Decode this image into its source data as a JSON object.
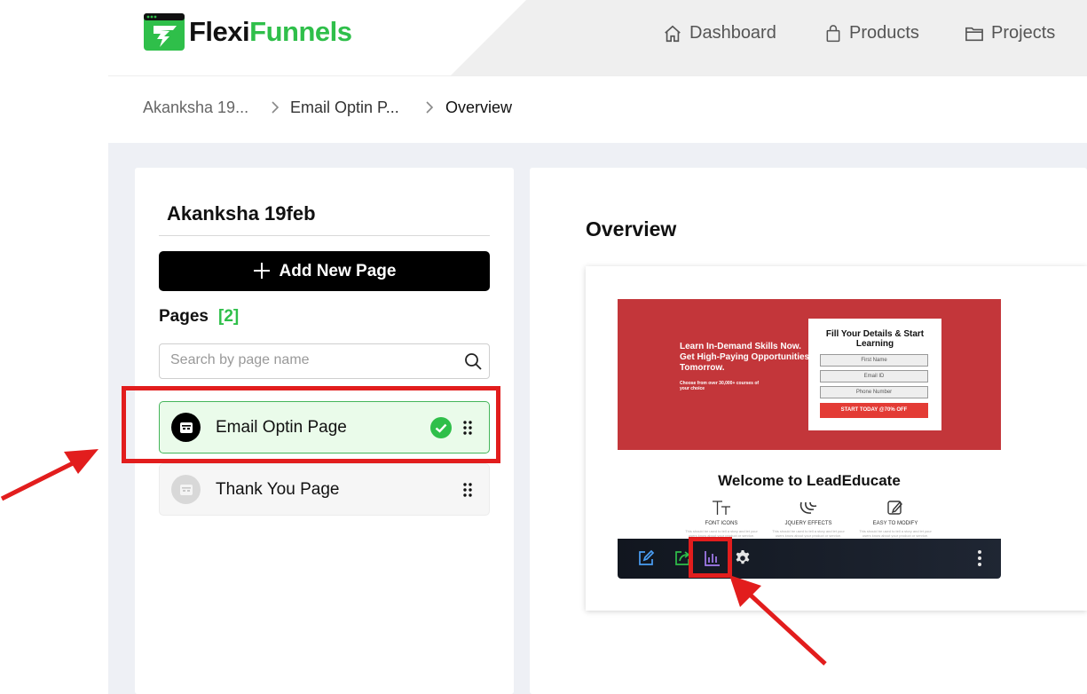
{
  "header": {
    "logo_part1": "Flexi",
    "logo_part2": "Funnels",
    "nav": [
      {
        "label": "Dashboard",
        "icon": "home-icon"
      },
      {
        "label": "Products",
        "icon": "shopping-bag-icon"
      },
      {
        "label": "Projects",
        "icon": "folder-icon"
      }
    ]
  },
  "breadcrumb": [
    "Akanksha 19...",
    "Email Optin P...",
    "Overview"
  ],
  "sidebar": {
    "project_title": "Akanksha 19feb",
    "add_button": "Add New Page",
    "pages_label": "Pages",
    "pages_count": "[2]",
    "search_placeholder": "Search by page name",
    "pages": [
      {
        "label": "Email Optin Page",
        "active": true
      },
      {
        "label": "Thank You Page",
        "active": false
      }
    ]
  },
  "main": {
    "title": "Overview",
    "preview": {
      "hero_headline": "Learn In-Demand Skills Now. Get High-Paying Opportunities Tomorrow.",
      "hero_sub": "Choose from over 30,000+ courses of your choice",
      "form_title": "Fill Your Details & Start Learning",
      "fields": [
        "First Name",
        "Email ID",
        "Phone Number"
      ],
      "form_button": "START TODAY @70% OFF",
      "welcome": "Welcome to LeadEducate",
      "features": [
        {
          "label": "FONT ICONS",
          "desc": "This should be used to tell a story and let your users know about your product or service."
        },
        {
          "label": "JQUERY EFFECTS",
          "desc": "This should be used to tell a story and let your users know about your product or service."
        },
        {
          "label": "EASY TO MODIFY",
          "desc": "This should be used to tell a story and let your users know about your product or service."
        }
      ]
    },
    "toolbar": [
      "edit-icon",
      "share-icon",
      "analytics-icon",
      "settings-icon",
      "more-vertical-icon"
    ]
  },
  "colors": {
    "brand_green": "#2fbf4a",
    "highlight_red": "#e21d1d",
    "hero_red": "#c3363a"
  }
}
